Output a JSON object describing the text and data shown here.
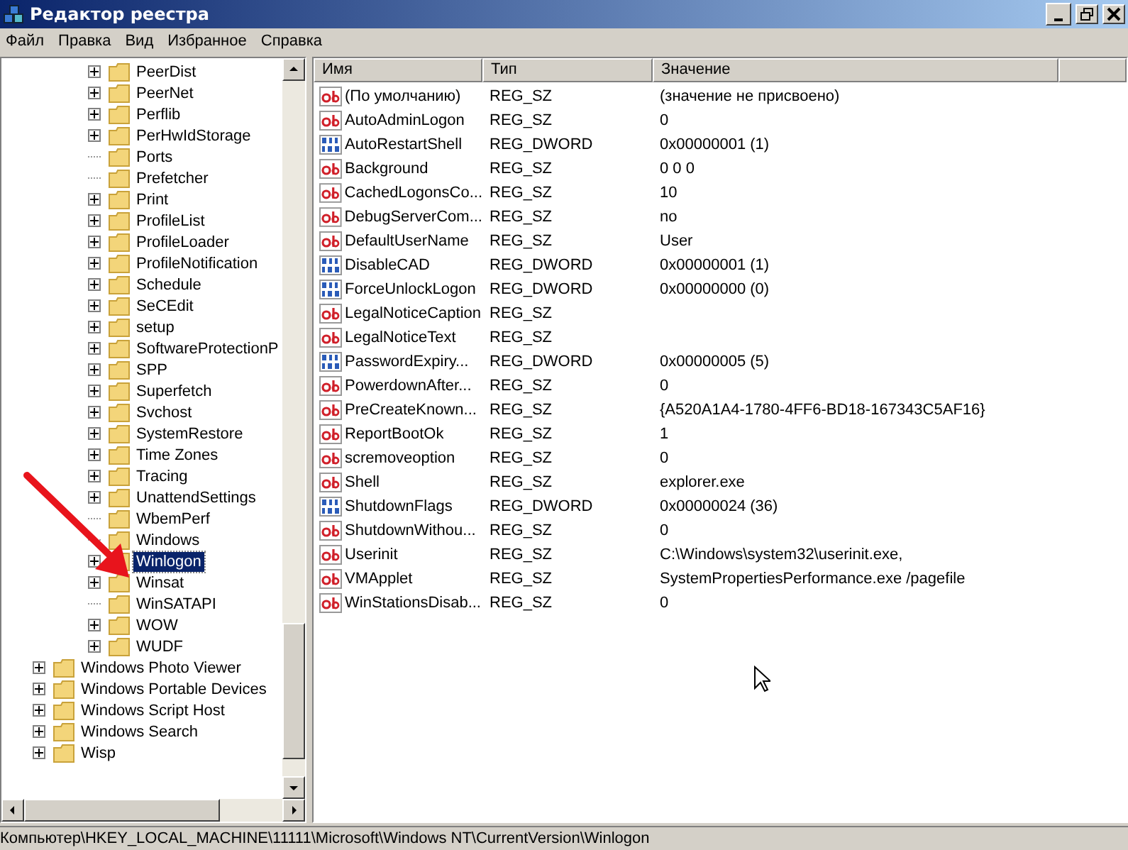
{
  "window": {
    "title": "Редактор реестра"
  },
  "menu": [
    "Файл",
    "Правка",
    "Вид",
    "Избранное",
    "Справка"
  ],
  "tree": {
    "items": [
      {
        "children": [
          {
            "label": "PeerDist",
            "expandable": true,
            "selected": false
          },
          {
            "label": "PeerNet",
            "expandable": true,
            "selected": false
          },
          {
            "label": "Perflib",
            "expandable": true,
            "selected": false
          },
          {
            "label": "PerHwIdStorage",
            "expandable": true,
            "selected": false
          },
          {
            "label": "Ports",
            "expandable": false,
            "selected": false
          },
          {
            "label": "Prefetcher",
            "expandable": false,
            "selected": false
          },
          {
            "label": "Print",
            "expandable": true,
            "selected": false
          },
          {
            "label": "ProfileList",
            "expandable": true,
            "selected": false
          },
          {
            "label": "ProfileLoader",
            "expandable": true,
            "selected": false
          },
          {
            "label": "ProfileNotification",
            "expandable": true,
            "selected": false
          },
          {
            "label": "Schedule",
            "expandable": true,
            "selected": false
          },
          {
            "label": "SeCEdit",
            "expandable": true,
            "selected": false
          },
          {
            "label": "setup",
            "expandable": true,
            "selected": false
          },
          {
            "label": "SoftwareProtectionP",
            "expandable": true,
            "selected": false
          },
          {
            "label": "SPP",
            "expandable": true,
            "selected": false
          },
          {
            "label": "Superfetch",
            "expandable": true,
            "selected": false
          },
          {
            "label": "Svchost",
            "expandable": true,
            "selected": false
          },
          {
            "label": "SystemRestore",
            "expandable": true,
            "selected": false
          },
          {
            "label": "Time Zones",
            "expandable": true,
            "selected": false
          },
          {
            "label": "Tracing",
            "expandable": true,
            "selected": false
          },
          {
            "label": "UnattendSettings",
            "expandable": true,
            "selected": false
          },
          {
            "label": "WbemPerf",
            "expandable": false,
            "selected": false
          },
          {
            "label": "Windows",
            "expandable": false,
            "selected": false
          },
          {
            "label": "Winlogon",
            "expandable": true,
            "selected": true
          },
          {
            "label": "Winsat",
            "expandable": true,
            "selected": false
          },
          {
            "label": "WinSATAPI",
            "expandable": false,
            "selected": false
          },
          {
            "label": "WOW",
            "expandable": true,
            "selected": false
          },
          {
            "label": "WUDF",
            "expandable": true,
            "selected": false
          }
        ]
      },
      {
        "label": "Windows Photo Viewer",
        "expandable": true,
        "selected": false
      },
      {
        "label": "Windows Portable Devices",
        "expandable": true,
        "selected": false
      },
      {
        "label": "Windows Script Host",
        "expandable": true,
        "selected": false
      },
      {
        "label": "Windows Search",
        "expandable": true,
        "selected": false
      },
      {
        "label": "Wisp",
        "expandable": true,
        "selected": false
      }
    ]
  },
  "values": {
    "columns": [
      "Имя",
      "Тип",
      "Значение"
    ],
    "rows": [
      {
        "kind": "string",
        "name": "(По умолчанию)",
        "type": "REG_SZ",
        "value": "(значение не присвоено)"
      },
      {
        "kind": "string",
        "name": "AutoAdminLogon",
        "type": "REG_SZ",
        "value": "0"
      },
      {
        "kind": "binary",
        "name": "AutoRestartShell",
        "type": "REG_DWORD",
        "value": "0x00000001 (1)"
      },
      {
        "kind": "string",
        "name": "Background",
        "type": "REG_SZ",
        "value": "0 0 0"
      },
      {
        "kind": "string",
        "name": "CachedLogonsCo...",
        "type": "REG_SZ",
        "value": "10"
      },
      {
        "kind": "string",
        "name": "DebugServerCom...",
        "type": "REG_SZ",
        "value": "no"
      },
      {
        "kind": "string",
        "name": "DefaultUserName",
        "type": "REG_SZ",
        "value": "User"
      },
      {
        "kind": "binary",
        "name": "DisableCAD",
        "type": "REG_DWORD",
        "value": "0x00000001 (1)"
      },
      {
        "kind": "binary",
        "name": "ForceUnlockLogon",
        "type": "REG_DWORD",
        "value": "0x00000000 (0)"
      },
      {
        "kind": "string",
        "name": "LegalNoticeCaption",
        "type": "REG_SZ"
      },
      {
        "kind": "string",
        "name": "LegalNoticeText",
        "type": "REG_SZ"
      },
      {
        "kind": "binary",
        "name": "PasswordExpiry...",
        "type": "REG_DWORD",
        "value": "0x00000005 (5)"
      },
      {
        "kind": "string",
        "name": "PowerdownAfter...",
        "type": "REG_SZ",
        "value": "0"
      },
      {
        "kind": "string",
        "name": "PreCreateKnown...",
        "type": "REG_SZ",
        "value": "{A520A1A4-1780-4FF6-BD18-167343C5AF16}"
      },
      {
        "kind": "string",
        "name": "ReportBootOk",
        "type": "REG_SZ",
        "value": "1"
      },
      {
        "kind": "string",
        "name": "scremoveoption",
        "type": "REG_SZ",
        "value": "0"
      },
      {
        "kind": "string",
        "name": "Shell",
        "type": "REG_SZ",
        "value": "explorer.exe"
      },
      {
        "kind": "binary",
        "name": "ShutdownFlags",
        "type": "REG_DWORD",
        "value": "0x00000024 (36)"
      },
      {
        "kind": "string",
        "name": "ShutdownWithou...",
        "type": "REG_SZ",
        "value": "0"
      },
      {
        "kind": "string",
        "name": "Userinit",
        "type": "REG_SZ",
        "value": "C:\\Windows\\system32\\userinit.exe,"
      },
      {
        "kind": "string",
        "name": "VMApplet",
        "type": "REG_SZ",
        "value": "SystemPropertiesPerformance.exe /pagefile"
      },
      {
        "kind": "string",
        "name": "WinStationsDisab...",
        "type": "REG_SZ",
        "value": "0"
      }
    ]
  },
  "status_bar": "Компьютер\\HKEY_LOCAL_MACHINE\\11111\\Microsoft\\Windows NT\\CurrentVersion\\Winlogon"
}
